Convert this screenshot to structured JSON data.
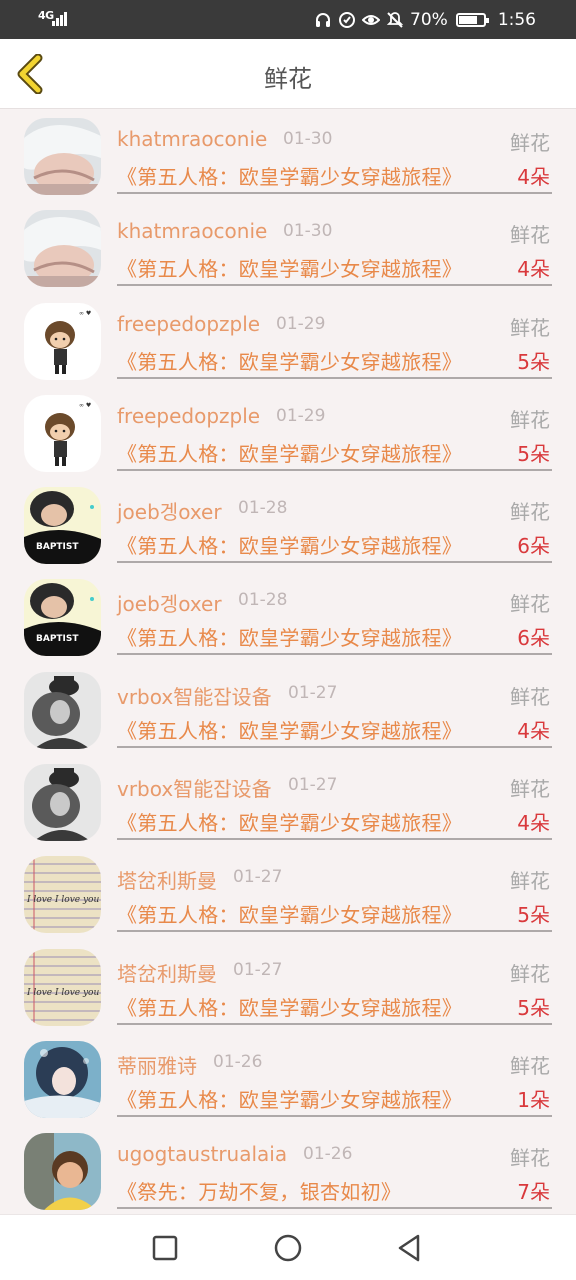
{
  "status_bar": {
    "network": "4G",
    "battery_percent": "70%",
    "battery_level": 0.7,
    "time": "1:56",
    "icons": [
      "headset-icon",
      "data-saver-icon",
      "eye-icon",
      "mute-icon"
    ]
  },
  "header": {
    "back_icon": "chevron-left-icon",
    "title": "鲜花"
  },
  "list": [
    {
      "user": "khatmraoconie",
      "date": "01-30",
      "type": "鲜花",
      "book": "《第五人格：欧皇学霸少女穿越旅程》",
      "count": "4朵",
      "avatar": "avatar-white-hair"
    },
    {
      "user": "khatmraoconie",
      "date": "01-30",
      "type": "鲜花",
      "book": "《第五人格：欧皇学霸少女穿越旅程》",
      "count": "4朵",
      "avatar": "avatar-white-hair"
    },
    {
      "user": "freepedopzple",
      "date": "01-29",
      "type": "鲜花",
      "book": "《第五人格：欧皇学霸少女穿越旅程》",
      "count": "5朵",
      "avatar": "avatar-chibi-boy"
    },
    {
      "user": "freepedopzple",
      "date": "01-29",
      "type": "鲜花",
      "book": "《第五人格：欧皇学霸少女穿越旅程》",
      "count": "5朵",
      "avatar": "avatar-chibi-boy"
    },
    {
      "user": "joeb겡oxer",
      "date": "01-28",
      "type": "鲜花",
      "book": "《第五人格：欧皇学霸少女穿越旅程》",
      "count": "6朵",
      "avatar": "avatar-baptist-shirt"
    },
    {
      "user": "joeb겡oxer",
      "date": "01-28",
      "type": "鲜花",
      "book": "《第五人格：欧皇学霸少女穿越旅程》",
      "count": "6朵",
      "avatar": "avatar-baptist-shirt"
    },
    {
      "user": "vrbox智能잡设备",
      "date": "01-27",
      "type": "鲜花",
      "book": "《第五人格：欧皇学霸少女穿越旅程》",
      "count": "4朵",
      "avatar": "avatar-bw-hat"
    },
    {
      "user": "vrbox智能잡设备",
      "date": "01-27",
      "type": "鲜花",
      "book": "《第五人格：欧皇学霸少女穿越旅程》",
      "count": "4朵",
      "avatar": "avatar-bw-hat"
    },
    {
      "user": "塔岔利斯曼",
      "date": "01-27",
      "type": "鲜花",
      "book": "《第五人格：欧皇学霸少女穿越旅程》",
      "count": "5朵",
      "avatar": "avatar-lined-paper"
    },
    {
      "user": "塔岔利斯曼",
      "date": "01-27",
      "type": "鲜花",
      "book": "《第五人格：欧皇学霸少女穿越旅程》",
      "count": "5朵",
      "avatar": "avatar-lined-paper"
    },
    {
      "user": "蒂丽雅诗",
      "date": "01-26",
      "type": "鲜花",
      "book": "《第五人格：欧皇学霸少女穿越旅程》",
      "count": "1朵",
      "avatar": "avatar-anime-girl"
    },
    {
      "user": "ugogtaustrualaia",
      "date": "01-26",
      "type": "鲜花",
      "book": "《祭先：万劫不复，银杏如初》",
      "count": "7朵",
      "avatar": "avatar-child-photo"
    }
  ],
  "avatar_text": {
    "lined_paper": "I love I love you",
    "baptist": "BAPTIST"
  },
  "navbar": {
    "recent_icon": "square-icon",
    "home_icon": "circle-icon",
    "back_icon": "triangle-back-icon"
  },
  "colors": {
    "status_bar": "#3a3a3a",
    "background": "#f7f2f2",
    "username": "#e89a6b",
    "book_title": "#e8894a",
    "count": "#d9393c",
    "label": "#a9a9a9"
  }
}
